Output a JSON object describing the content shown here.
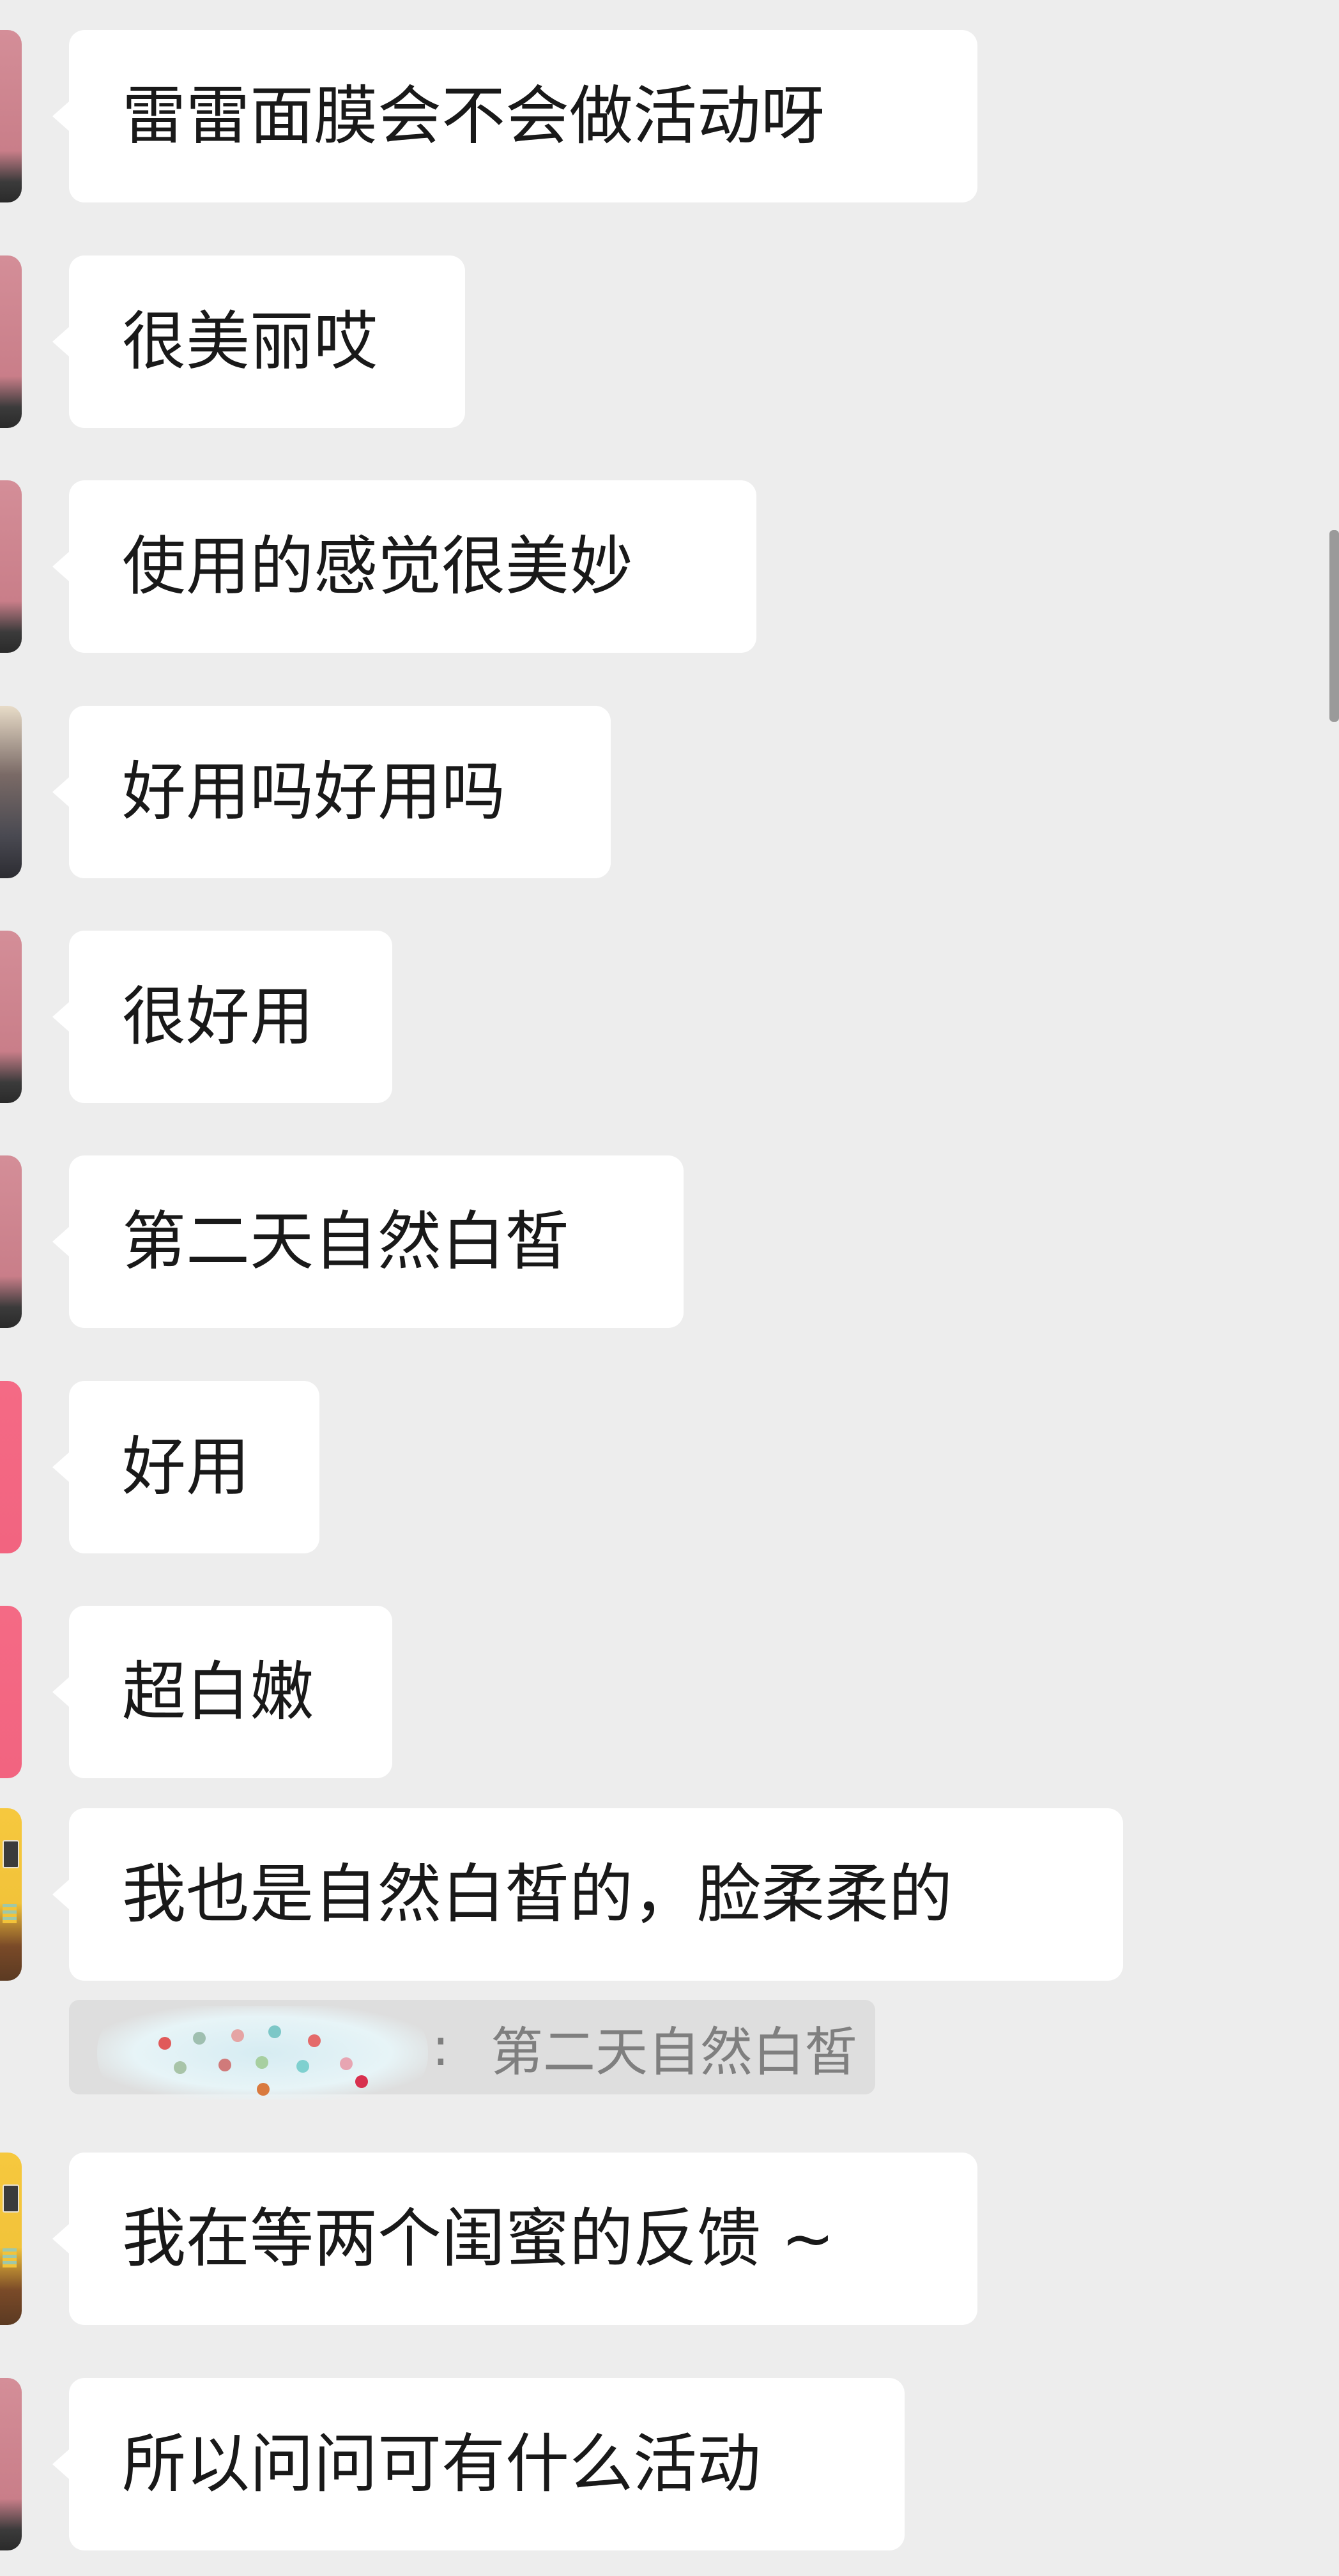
{
  "messages": [
    {
      "text": "雷雷面膜会不会做活动呀"
    },
    {
      "text": "很美丽哎"
    },
    {
      "text": "使用的感觉很美妙"
    },
    {
      "text": "好用吗好用吗"
    },
    {
      "text": "很好用"
    },
    {
      "text": "第二天自然白皙"
    },
    {
      "text": "好用"
    },
    {
      "text": "超白嫩"
    },
    {
      "text": "我也是自然白皙的，脸柔柔的"
    },
    {
      "text": "我在等两个闺蜜的反馈 ~"
    },
    {
      "text": "所以问问可有什么活动"
    }
  ],
  "quote": {
    "separator": ":",
    "text": "第二天自然白皙"
  }
}
